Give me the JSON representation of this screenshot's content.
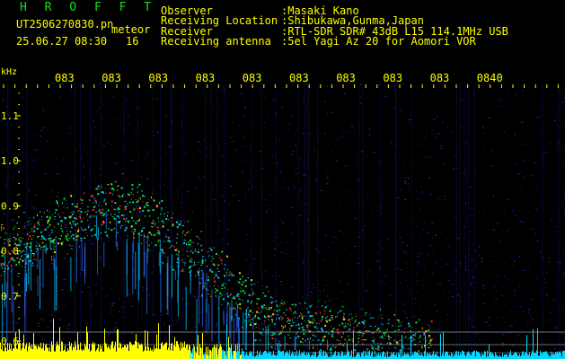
{
  "header": {
    "brand": "H R O F F T",
    "filename": "UT2506270830.pn",
    "mode": "meteor",
    "datetime": "25.06.27 08:30",
    "count": "16",
    "info": [
      {
        "label": "Observer",
        "value": ":Masaki Kano"
      },
      {
        "label": "Receiving Location",
        "value": ":Shibukawa,Gunma,Japan"
      },
      {
        "label": "Receiver",
        "value": ":RTL-SDR SDR# 43dB L15 114.1MHz USB"
      },
      {
        "label": "Receiving antenna",
        "value": ":5el Yagi Az 20 for Aomori VOR"
      }
    ]
  },
  "spectrogram": {
    "unit_label": "kHz",
    "time_ticks": [
      "083",
      "083",
      "083",
      "083",
      "083",
      "083",
      "083",
      "083",
      "083",
      "0840"
    ],
    "freq_ticks": [
      {
        "value": 1.1,
        "label": "1.1"
      },
      {
        "value": 1.0,
        "label": "1.0"
      },
      {
        "value": 0.9,
        "label": "0.9"
      },
      {
        "value": 0.8,
        "label": "0.8"
      },
      {
        "value": 0.7,
        "label": "0.7"
      },
      {
        "value": 0.6,
        "label": "0.6"
      }
    ],
    "colors": {
      "text": "#ffff00",
      "tick": "#ffff00",
      "background": "#000000",
      "noise": "#1a1a8c",
      "signal_hot": "#ff2020",
      "signal_mid": "#00e040",
      "signal_cool": "#00c8ff",
      "baseline": "#ffff00"
    }
  }
}
